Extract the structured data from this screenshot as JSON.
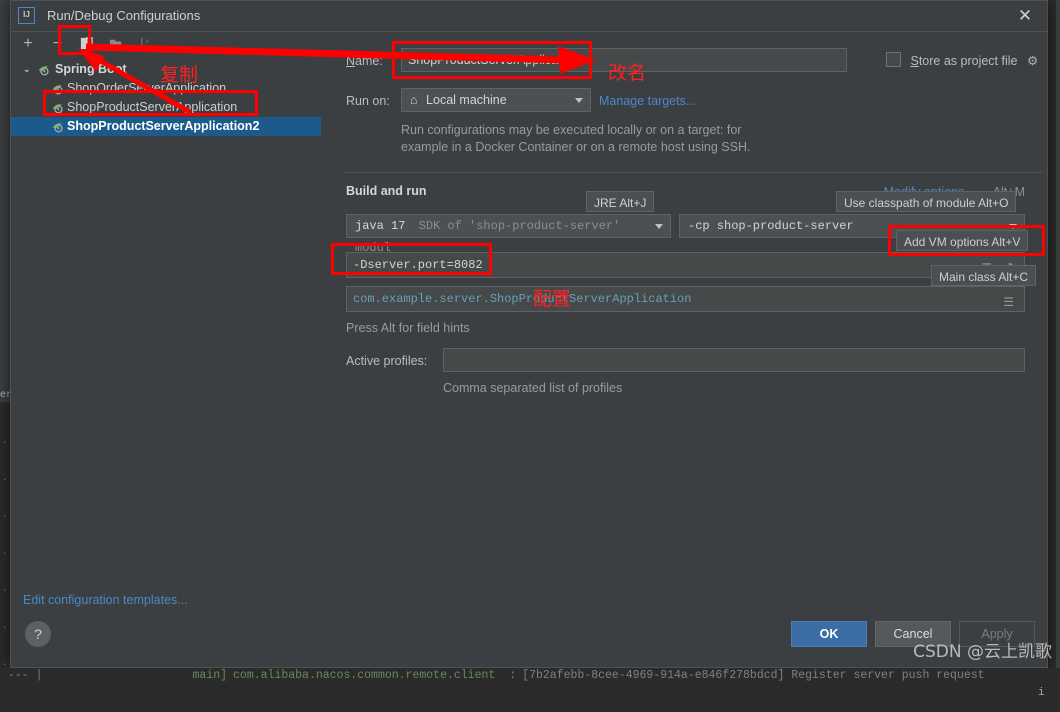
{
  "window": {
    "title": "Run/Debug Configurations",
    "logo_text": "IJ",
    "close_label": "✕"
  },
  "toolbar": {
    "add_label": "+",
    "remove_label": "−",
    "copy_label": "copy-configuration",
    "save_label": "save-configuration",
    "sort_label": "sort-configurations"
  },
  "tree": {
    "group": {
      "label": "Spring Boot",
      "chevron": "⌄"
    },
    "items": [
      {
        "label": "ShopOrderServerApplication",
        "selected": false
      },
      {
        "label": "ShopProductServerApplication",
        "selected": false
      },
      {
        "label": "ShopProductServerApplication2",
        "selected": true
      }
    ],
    "edit_templates_label": "Edit configuration templates..."
  },
  "form": {
    "name_label": "Name:",
    "name_value": "ShopProductServerApplication2",
    "store_as_project_file_label": "Store as project file",
    "store_as_project_file_checked": false,
    "run_on_label": "Run on:",
    "run_on_value": "Local machine",
    "manage_targets_label": "Manage targets...",
    "run_on_hint_line1": "Run configurations may be executed locally or on a target: for",
    "run_on_hint_line2": "example in a Docker Container or on a remote host using SSH.",
    "build_and_run_label": "Build and run",
    "modify_options_label": "Modify options",
    "modify_options_chevron": "⌄",
    "modify_options_shortcut": "Alt+M",
    "jre_value_bold": "java 17",
    "jre_value_dim": "SDK of 'shop-product-server' modul",
    "classpath_value": "-cp shop-product-server",
    "vm_options_value": "-Dserver.port=8082",
    "main_class_value": "com.example.server.ShopProductServerApplication",
    "press_alt_hint": "Press Alt for field hints",
    "active_profiles_label": "Active profiles:",
    "active_profiles_value": "",
    "active_profiles_hint": "Comma separated list of profiles"
  },
  "tooltips": {
    "jre": "JRE Alt+J",
    "use_classpath_of_module": "Use classpath of module Alt+O",
    "add_vm_options": "Add VM options Alt+V",
    "main_class": "Main class Alt+C"
  },
  "footer": {
    "help_label": "?",
    "ok_label": "OK",
    "cancel_label": "Cancel",
    "apply_label": "Apply"
  },
  "annotations": {
    "copy_text": "复制",
    "rename_text": "改名",
    "config_text": "配置"
  },
  "console": {
    "dashes": "--- |",
    "thread": "main]",
    "logger": "com.alibaba.nacos.common.remote.client",
    "colon": ":",
    "message": "[7b2afebb-8cee-4969-914a-e846f278bdcd] Register server push request"
  },
  "background": {
    "left_snippet": "er",
    "right_column": "1 a r t c r i"
  },
  "watermark": "CSDN @云上凯歌",
  "colors": {
    "accent": "#4a88c7",
    "selection": "#1c5a8c",
    "annotation": "#ff0000",
    "ok_button": "#3b6ea5",
    "panel": "#3c3f41",
    "field": "#45494a"
  }
}
